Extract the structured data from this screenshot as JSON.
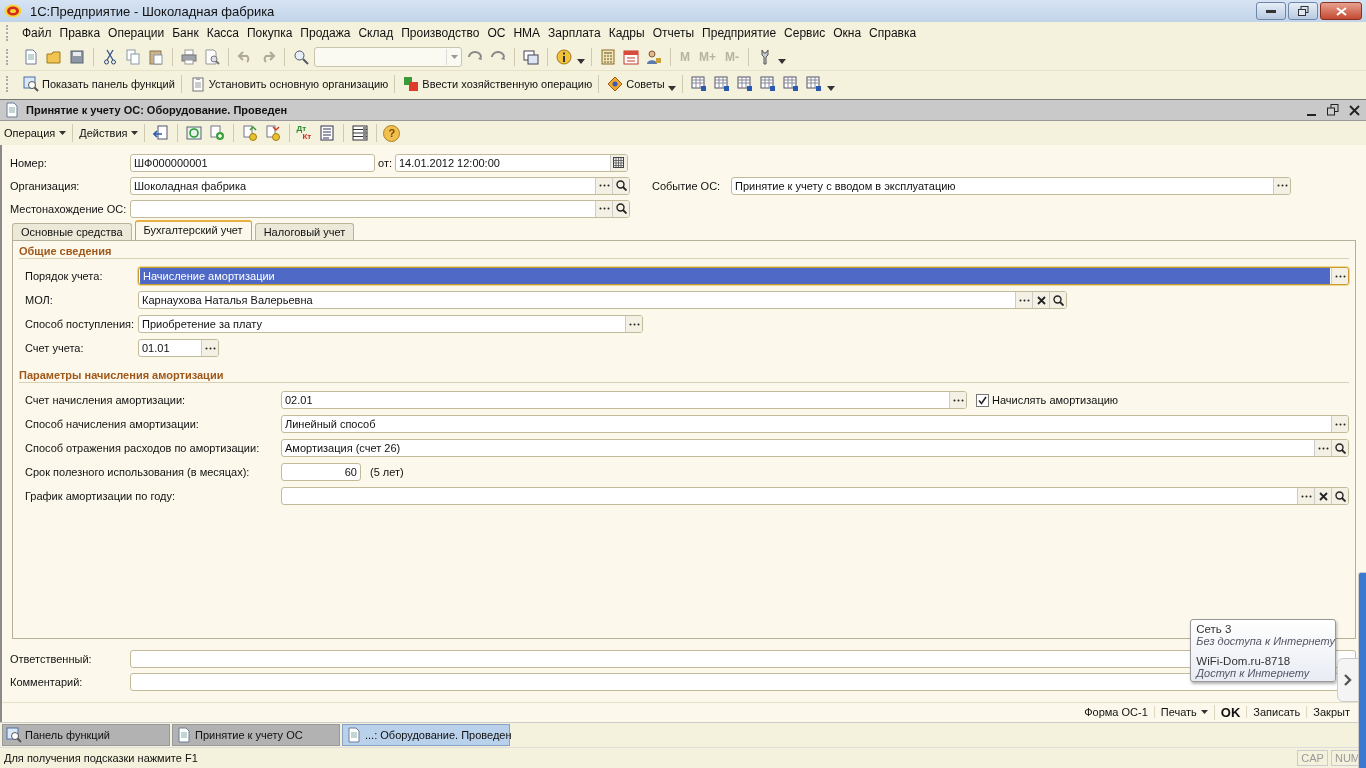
{
  "window": {
    "title": "1С:Предприятие - Шоколадная фабрика"
  },
  "menu": [
    "Файл",
    "Правка",
    "Операции",
    "Банк",
    "Касса",
    "Покупка",
    "Продажа",
    "Склад",
    "Производство",
    "ОС",
    "НМА",
    "Зарплата",
    "Кадры",
    "Отчеты",
    "Предприятие",
    "Сервис",
    "Окна",
    "Справка"
  ],
  "toolbar": {
    "memory_buttons": [
      {
        "label": "M",
        "disabled": true
      },
      {
        "label": "M+",
        "disabled": true
      },
      {
        "label": "M-",
        "disabled": true
      }
    ]
  },
  "panel_toolbar": {
    "buttons": [
      {
        "label": "Показать панель функций",
        "kind": "functions"
      },
      {
        "label": "Установить основную организацию",
        "kind": "organization"
      },
      {
        "label": "Ввести хозяйственную операцию",
        "kind": "operation"
      },
      {
        "label": "Советы",
        "kind": "tips"
      }
    ]
  },
  "document": {
    "title": "Принятие к учету ОС: Оборудование. Проведен",
    "toolbar": {
      "menus": [
        "Операция",
        "Действия"
      ],
      "dt_kt": [
        "Дт",
        "Кт"
      ],
      "help": "?"
    },
    "header": {
      "number": {
        "label": "Номер:",
        "value": "ШФ000000001"
      },
      "date": {
        "label": "от:",
        "value": "14.01.2012 12:00:00",
        "buttons": [
          {
            "kind": "calendar"
          }
        ]
      },
      "organization": {
        "label": "Организация:",
        "value": "Шоколадная фабрика",
        "buttons": [
          {
            "kind": "select"
          },
          {
            "kind": "search"
          }
        ]
      },
      "event": {
        "label": "Событие ОС:",
        "value": "Принятие к учету с вводом в эксплуатацию",
        "buttons": [
          {
            "kind": "select"
          }
        ]
      },
      "location": {
        "label": "Местонахождение ОС:",
        "buttons": [
          {
            "kind": "select"
          },
          {
            "kind": "search"
          }
        ]
      }
    },
    "tabs": [
      {
        "label": "Основные средства",
        "selected": false
      },
      {
        "label": "Бухгалтерский учет",
        "selected": true
      },
      {
        "label": "Налоговый учет",
        "selected": false
      }
    ],
    "sections": [
      {
        "title": "Общие сведения",
        "kind": "narrow",
        "fields": [
          {
            "kind": "full",
            "label": "Порядок учета:",
            "value": "Начисление амортизации",
            "focused": true,
            "buttons": [
              {
                "kind": "select"
              }
            ]
          },
          {
            "kind": "long",
            "label": "МОЛ:",
            "value": "Карнаухова Наталья Валерьевна",
            "focused": false,
            "buttons": [
              {
                "kind": "select"
              },
              {
                "kind": "clear"
              },
              {
                "kind": "search"
              }
            ]
          },
          {
            "kind": "medium",
            "label": "Способ поступления:",
            "value": "Приобретение за плату",
            "focused": false,
            "buttons": [
              {
                "kind": "select"
              }
            ]
          },
          {
            "kind": "short",
            "label": "Счет учета:",
            "value": "01.01",
            "focused": false,
            "buttons": [
              {
                "kind": "select"
              }
            ]
          }
        ]
      },
      {
        "title": "Параметры начисления амортизации",
        "kind": "wide",
        "fields": [
          {
            "kind": "check",
            "label": "Счет начисления амортизации:",
            "value": "02.01",
            "focused": false,
            "buttons": [
              {
                "kind": "select"
              }
            ],
            "checkbox": {
              "label": "Начислять амортизацию",
              "checked": true
            }
          },
          {
            "kind": "full",
            "label": "Способ начисления амортизации:",
            "value": "Линейный способ",
            "focused": false,
            "buttons": [
              {
                "kind": "select"
              }
            ]
          },
          {
            "kind": "full",
            "label": "Способ отражения расходов по амортизации:",
            "value": "Амортизация (счет 26)",
            "focused": false,
            "buttons": [
              {
                "kind": "select"
              },
              {
                "kind": "search"
              }
            ]
          },
          {
            "kind": "number",
            "label": "Срок полезного использования (в месяцах):",
            "value": "60",
            "focused": false,
            "suffix": "(5 лет)"
          },
          {
            "kind": "full",
            "label": "График амортизации по году:",
            "focused": false,
            "buttons": [
              {
                "kind": "select"
              },
              {
                "kind": "clear"
              },
              {
                "kind": "search"
              }
            ]
          }
        ]
      }
    ],
    "footer_fields": [
      {
        "label": "Ответственный:"
      },
      {
        "label": "Комментарий:"
      }
    ],
    "actions": [
      {
        "label": "Форма ОС-1",
        "kind": "plain"
      },
      {
        "label": "Печать",
        "kind": "menu"
      },
      {
        "label": "OK",
        "kind": "default"
      },
      {
        "label": "Записать",
        "kind": "plain"
      },
      {
        "label": "Закрыт",
        "kind": "plain"
      }
    ]
  },
  "window_tabs": [
    {
      "label": "Панель функций",
      "kind": "functions",
      "selected": false
    },
    {
      "label": "Принятие к учету ОС",
      "kind": "document",
      "selected": false
    },
    {
      "label": "...: Оборудование. Проведен",
      "kind": "document",
      "selected": true
    }
  ],
  "status_bar": {
    "hint": "Для получения подсказки нажмите F1",
    "indicators": [
      "CAP",
      "NUM"
    ]
  },
  "network_popup": {
    "networks": [
      {
        "name": "Сеть  3",
        "status": "Без доступа к Интернету"
      },
      {
        "name": "WiFi-Dom.ru-8718",
        "status": "Доступ к Интернету"
      }
    ]
  }
}
